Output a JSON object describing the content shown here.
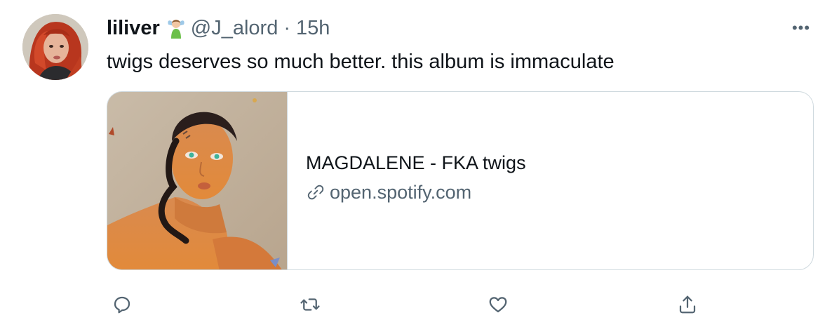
{
  "author": {
    "display_name": "liliver",
    "handle": "@J_alord",
    "separator": "·",
    "time": "15h",
    "name_emoji": "fairy-emoji"
  },
  "more_label": "•••",
  "tweet": {
    "text": "twigs deserves so much better. this album is immaculate"
  },
  "card": {
    "title": "MAGDALENE - FKA twigs",
    "domain": "open.spotify.com"
  },
  "actions": [
    "reply-icon",
    "retweet-icon",
    "like-icon",
    "share-icon"
  ],
  "colors": {
    "text_primary": "#0f1419",
    "text_secondary": "#536471",
    "border": "#cfd9de"
  }
}
